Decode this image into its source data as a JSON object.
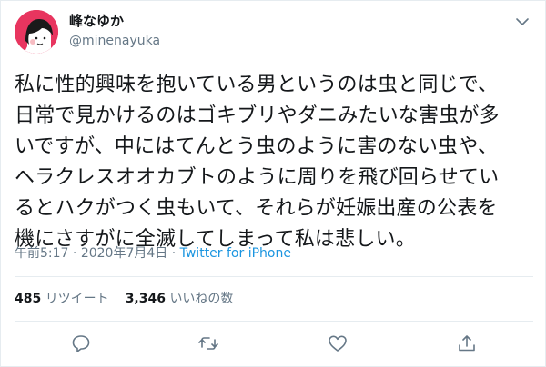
{
  "user": {
    "display_name": "峰なゆか",
    "handle": "@minenayuka"
  },
  "tweet": {
    "text": "私に性的興味を抱いている男というのは虫と同じで、\n日常で見かけるのはゴキブリやダニみたいな害虫が多\nいですが、中にはてんとう虫のように害のない虫や、\nヘラクレスオオカブトのように周りを飛び回らせてい\nるとハクがつく虫もいて、それらが妊娠出産の公表を\n機にさすがに全滅してしまって私は悲しい。",
    "time": "午前5:17",
    "separator": " · ",
    "date": "2020年7月4日",
    "source": "Twitter for iPhone"
  },
  "stats": {
    "retweets_count": "485",
    "retweets_label": "リツイート",
    "likes_count": "3,346",
    "likes_label": "いいねの数"
  },
  "icons": {
    "caret": "chevron-down-icon",
    "reply": "reply-icon",
    "retweet": "retweet-icon",
    "like": "heart-icon",
    "share": "share-icon"
  },
  "colors": {
    "avatar_bg": "#e8355f",
    "link": "#1b95e0",
    "muted": "#657786",
    "text": "#14171a"
  }
}
